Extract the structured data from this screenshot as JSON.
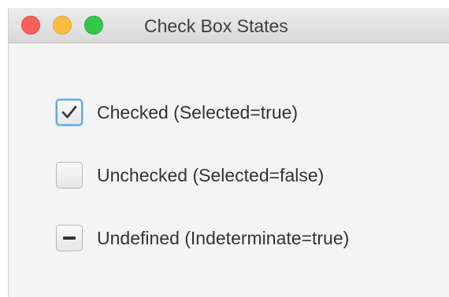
{
  "window": {
    "title": "Check Box States",
    "buttons": {
      "close": "close-button",
      "minimize": "minimize-button",
      "maximize": "maximize-button"
    }
  },
  "checkboxes": [
    {
      "label": "Checked (Selected=true)",
      "state": "checked"
    },
    {
      "label": "Unchecked (Selected=false)",
      "state": "unchecked"
    },
    {
      "label": "Undefined (Indeterminate=true)",
      "state": "indeterminate"
    }
  ],
  "colors": {
    "focus_ring": "#5ca8e8",
    "close": "#fc605c",
    "minimize": "#fdbc40",
    "maximize": "#34c84a"
  }
}
